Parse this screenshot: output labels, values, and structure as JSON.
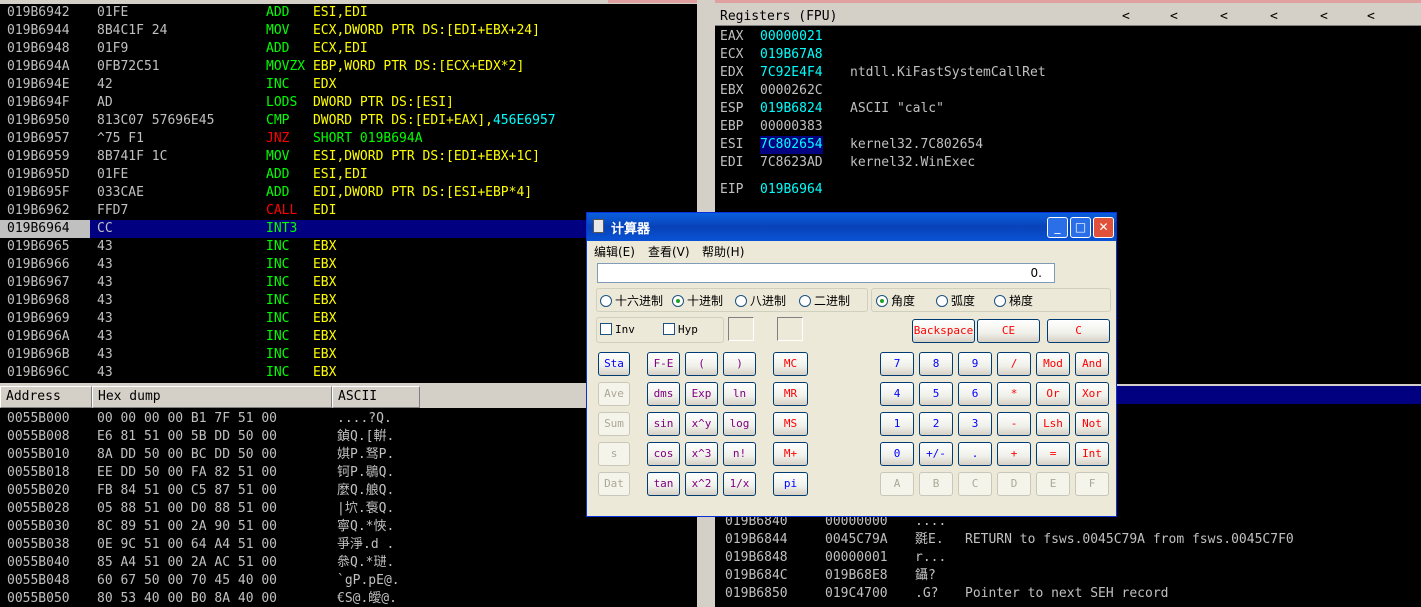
{
  "disasm": [
    {
      "addr": "019B6942",
      "hex": "01FE",
      "op": "ADD",
      "args": "ESI,EDI",
      "opColor": "green",
      "argColor": "yellow"
    },
    {
      "addr": "019B6944",
      "hex": "8B4C1F 24",
      "op": "MOV",
      "args": "ECX,DWORD PTR DS:[EDI+EBX+24]",
      "opColor": "green",
      "argColor": "yellow"
    },
    {
      "addr": "019B6948",
      "hex": "01F9",
      "op": "ADD",
      "args": "ECX,EDI",
      "opColor": "green",
      "argColor": "yellow"
    },
    {
      "addr": "019B694A",
      "hex": "0FB72C51",
      "op": "MOVZX",
      "args": "EBP,WORD PTR DS:[ECX+EDX*2]",
      "opColor": "green",
      "argColor": "yellow"
    },
    {
      "addr": "019B694E",
      "hex": "42",
      "op": "INC",
      "args": "EDX",
      "opColor": "green",
      "argColor": "yellow"
    },
    {
      "addr": "019B694F",
      "hex": "AD",
      "op": "LODS",
      "args": "DWORD PTR DS:[ESI]",
      "opColor": "green",
      "argColor": "yellow"
    },
    {
      "addr": "019B6950",
      "hex": "813C07 57696E45",
      "op": "CMP",
      "args": "DWORD PTR DS:[EDI+EAX],",
      "extra": "456E6957",
      "opColor": "green",
      "argColor": "yellow"
    },
    {
      "addr": "019B6957",
      "hex": "^75 F1",
      "op": "JNZ",
      "args": "SHORT 019B694A",
      "opColor": "red",
      "argColor": "green"
    },
    {
      "addr": "019B6959",
      "hex": "8B741F 1C",
      "op": "MOV",
      "args": "ESI,DWORD PTR DS:[EDI+EBX+1C]",
      "opColor": "green",
      "argColor": "yellow"
    },
    {
      "addr": "019B695D",
      "hex": "01FE",
      "op": "ADD",
      "args": "ESI,EDI",
      "opColor": "green",
      "argColor": "yellow"
    },
    {
      "addr": "019B695F",
      "hex": "033CAE",
      "op": "ADD",
      "args": "EDI,DWORD PTR DS:[ESI+EBP*4]",
      "opColor": "green",
      "argColor": "yellow"
    },
    {
      "addr": "019B6962",
      "hex": "FFD7",
      "op": "CALL",
      "args": "EDI",
      "opColor": "red",
      "argColor": "yellow"
    },
    {
      "addr": "019B6964",
      "hex": "CC",
      "op": "INT3",
      "args": "",
      "opColor": "green",
      "argColor": "yellow",
      "selected": true
    },
    {
      "addr": "019B6965",
      "hex": "43",
      "op": "INC",
      "args": "EBX",
      "opColor": "green",
      "argColor": "yellow"
    },
    {
      "addr": "019B6966",
      "hex": "43",
      "op": "INC",
      "args": "EBX",
      "opColor": "green",
      "argColor": "yellow"
    },
    {
      "addr": "019B6967",
      "hex": "43",
      "op": "INC",
      "args": "EBX",
      "opColor": "green",
      "argColor": "yellow"
    },
    {
      "addr": "019B6968",
      "hex": "43",
      "op": "INC",
      "args": "EBX",
      "opColor": "green",
      "argColor": "yellow"
    },
    {
      "addr": "019B6969",
      "hex": "43",
      "op": "INC",
      "args": "EBX",
      "opColor": "green",
      "argColor": "yellow"
    },
    {
      "addr": "019B696A",
      "hex": "43",
      "op": "INC",
      "args": "EBX",
      "opColor": "green",
      "argColor": "yellow"
    },
    {
      "addr": "019B696B",
      "hex": "43",
      "op": "INC",
      "args": "EBX",
      "opColor": "green",
      "argColor": "yellow"
    },
    {
      "addr": "019B696C",
      "hex": "43",
      "op": "INC",
      "args": "EBX",
      "opColor": "green",
      "argColor": "yellow"
    }
  ],
  "registers": {
    "title": "Registers (FPU)",
    "arrows": [
      "<",
      "<",
      "<",
      "<",
      "<",
      "<"
    ],
    "rows": [
      {
        "name": "EAX",
        "value": "00000021",
        "comment": "",
        "color": "cyan"
      },
      {
        "name": "ECX",
        "value": "019B67A8",
        "comment": "",
        "color": "cyan"
      },
      {
        "name": "EDX",
        "value": "7C92E4F4",
        "comment": "ntdll.KiFastSystemCallRet",
        "color": "cyan"
      },
      {
        "name": "EBX",
        "value": "0000262C",
        "comment": "",
        "color": "grey"
      },
      {
        "name": "ESP",
        "value": "019B6824",
        "comment": "ASCII \"calc\"",
        "color": "cyan"
      },
      {
        "name": "EBP",
        "value": "00000383",
        "comment": "",
        "color": "grey"
      },
      {
        "name": "ESI",
        "value": "7C802654",
        "comment": "kernel32.7C802654",
        "color": "cyan",
        "highlight": true
      },
      {
        "name": "EDI",
        "value": "7C8623AD",
        "comment": "kernel32.WinExec",
        "color": "grey"
      }
    ],
    "eip": {
      "name": "EIP",
      "value": "019B6964"
    }
  },
  "dump": {
    "headers": [
      "Address",
      "Hex dump",
      "ASCII"
    ],
    "rows": [
      {
        "addr": "0055B000",
        "hex": "00 00 00 00 B1 7F 51 00",
        "ascii": "....?Q."
      },
      {
        "addr": "0055B008",
        "hex": "E6 81 51 00 5B DD 50 00",
        "ascii": "鍞Q.[輧."
      },
      {
        "addr": "0055B010",
        "hex": "8A DD 50 00 BC DD 50 00",
        "ascii": "娸P.驽P."
      },
      {
        "addr": "0055B018",
        "hex": "EE DD 50 00 FA 82 51 00",
        "ascii": "钶P.鶡Q."
      },
      {
        "addr": "0055B020",
        "hex": "FB 84 51 00 C5 87 51 00",
        "ascii": "麼Q.艆Q."
      },
      {
        "addr": "0055B028",
        "hex": "05 88 51 00 D0 88 51 00",
        "ascii": "|坹.袌Q."
      },
      {
        "addr": "0055B030",
        "hex": "8C 89 51 00 2A 90 51 00",
        "ascii": "寧Q.*悏."
      },
      {
        "addr": "0055B038",
        "hex": "0E 9C 51 00 64 A4 51 00",
        "ascii": "爭淨.d ."
      },
      {
        "addr": "0055B040",
        "hex": "85 A4 51 00 2A AC 51 00",
        "ascii": "叅Q.*琎."
      },
      {
        "addr": "0055B048",
        "hex": "60 67 50 00 70 45 40 00",
        "ascii": "`gP.pE@."
      },
      {
        "addr": "0055B050",
        "hex": "80 53 40 00 B0 8A 40 00",
        "ascii": "€S@.皧@."
      }
    ]
  },
  "stack": [
    {
      "addr": "019B6840",
      "value": "00000000",
      "ascii": "....",
      "comment": ""
    },
    {
      "addr": "019B6844",
      "value": "0045C79A",
      "ascii": "毲E.",
      "comment": "RETURN to fsws.0045C79A from fsws.0045C7F0"
    },
    {
      "addr": "019B6848",
      "value": "00000001",
      "ascii": "r...",
      "comment": ""
    },
    {
      "addr": "019B684C",
      "value": "019B68E8",
      "ascii": "鑷?",
      "comment": ""
    },
    {
      "addr": "019B6850",
      "value": "019C4700",
      "ascii": ".G?",
      "comment": "Pointer to next SEH record"
    }
  ],
  "calculator": {
    "title": "计算器",
    "title_buttons": [
      "_",
      "□",
      "✕"
    ],
    "menu": [
      "编辑(E)",
      "查看(V)",
      "帮助(H)"
    ],
    "display": "0.",
    "radix": [
      {
        "label": "十六进制",
        "checked": false
      },
      {
        "label": "十进制",
        "checked": true
      },
      {
        "label": "八进制",
        "checked": false
      },
      {
        "label": "二进制",
        "checked": false
      }
    ],
    "angle": [
      {
        "label": "角度",
        "checked": true
      },
      {
        "label": "弧度",
        "checked": false
      },
      {
        "label": "梯度",
        "checked": false
      }
    ],
    "checks": [
      "Inv",
      "Hyp"
    ],
    "clear_buttons": [
      "Backspace",
      "CE",
      "C"
    ],
    "sci_left": [
      "Sta",
      "Ave",
      "Sum",
      "s",
      "Dat"
    ],
    "sci_grid": [
      [
        "F-E",
        "(",
        ")"
      ],
      [
        "dms",
        "Exp",
        "ln"
      ],
      [
        "sin",
        "x^y",
        "log"
      ],
      [
        "cos",
        "x^3",
        "n!"
      ],
      [
        "tan",
        "x^2",
        "1/x"
      ]
    ],
    "memory": [
      "MC",
      "MR",
      "MS",
      "M+",
      "pi"
    ],
    "keypad": [
      [
        "7",
        "8",
        "9",
        "/",
        "Mod",
        "And"
      ],
      [
        "4",
        "5",
        "6",
        "*",
        "Or",
        "Xor"
      ],
      [
        "1",
        "2",
        "3",
        "-",
        "Lsh",
        "Not"
      ],
      [
        "0",
        "+/-",
        ".",
        "+",
        "=",
        "Int"
      ],
      [
        "A",
        "B",
        "C",
        "D",
        "E",
        "F"
      ]
    ]
  }
}
